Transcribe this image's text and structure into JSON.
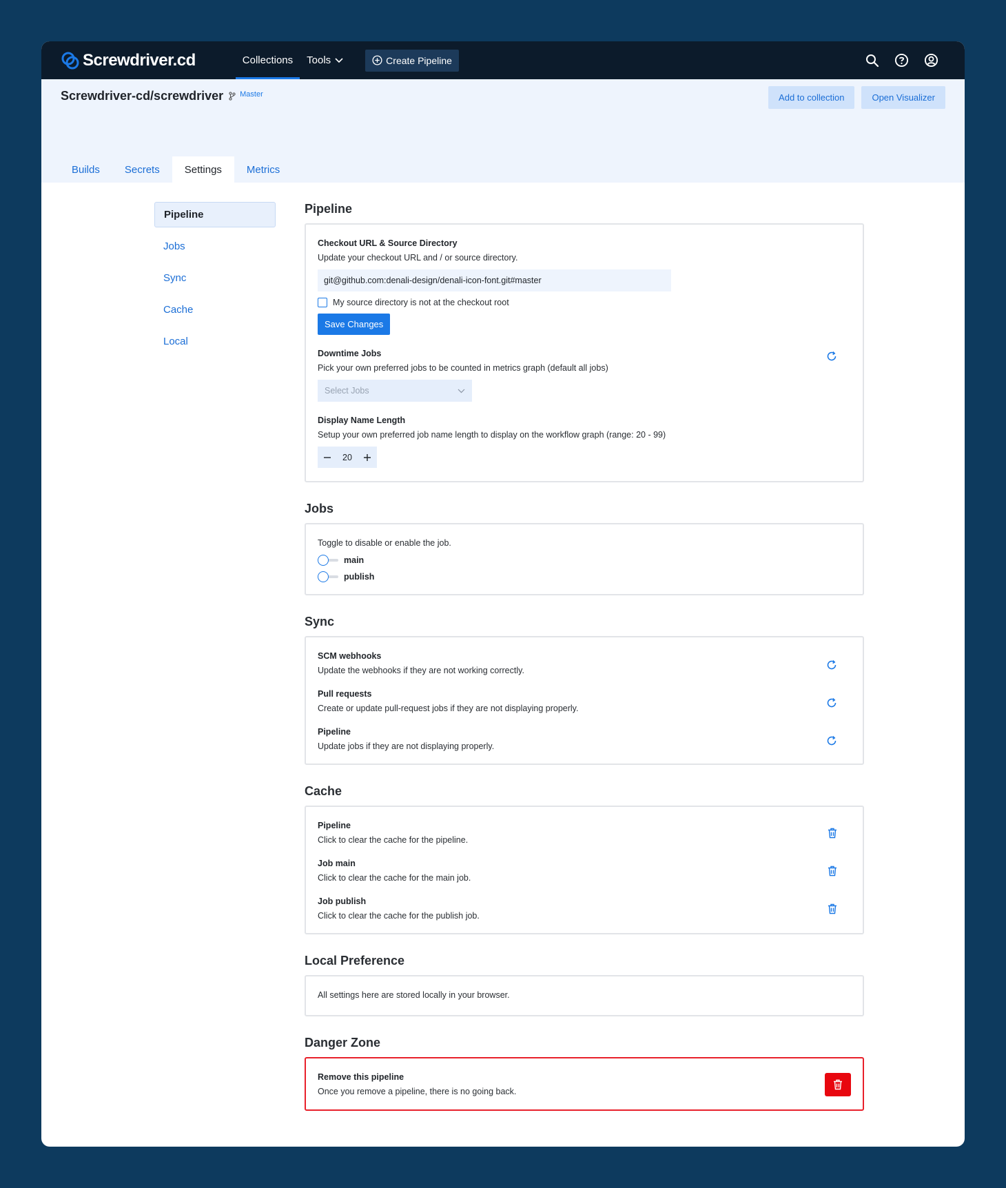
{
  "app": {
    "brand": "Screwdriver.cd"
  },
  "nav": {
    "collections": "Collections",
    "tools": "Tools",
    "create_pipeline": "Create Pipeline"
  },
  "header": {
    "repo": "Screwdriver-cd/screwdriver",
    "branch": "Master",
    "add_to_collection": "Add to collection",
    "open_visualizer": "Open Visualizer",
    "tabs": [
      "Builds",
      "Secrets",
      "Settings",
      "Metrics"
    ],
    "active_tab": "Settings"
  },
  "sidebar": {
    "items": [
      "Pipeline",
      "Jobs",
      "Sync",
      "Cache",
      "Local"
    ],
    "active": "Pipeline"
  },
  "pipeline": {
    "title": "Pipeline",
    "checkout": {
      "label": "Checkout URL & Source Directory",
      "desc": "Update your checkout URL and / or source directory.",
      "value": "git@github.com:denali-design/denali-icon-font.git#master",
      "checkbox_label": "My source directory is not at the checkout root",
      "checkbox_checked": false,
      "save": "Save Changes"
    },
    "downtime": {
      "label": "Downtime Jobs",
      "desc": "Pick your own preferred jobs to be counted in metrics graph (default all jobs)",
      "placeholder": "Select Jobs"
    },
    "display_length": {
      "label": "Display Name Length",
      "desc": "Setup your own preferred job name length to display on the workflow graph (range: 20 - 99)",
      "value": "20"
    }
  },
  "jobs": {
    "title": "Jobs",
    "desc": "Toggle to disable or enable the job.",
    "list": [
      {
        "name": "main",
        "enabled": false
      },
      {
        "name": "publish",
        "enabled": false
      }
    ]
  },
  "sync": {
    "title": "Sync",
    "items": [
      {
        "label": "SCM webhooks",
        "desc": "Update the webhooks if they are not working correctly."
      },
      {
        "label": "Pull requests",
        "desc": "Create or update pull-request jobs if they are not displaying properly."
      },
      {
        "label": "Pipeline",
        "desc": "Update jobs if they are not displaying properly."
      }
    ]
  },
  "cache": {
    "title": "Cache",
    "items": [
      {
        "label": "Pipeline",
        "desc": "Click to clear the cache for the pipeline."
      },
      {
        "label": "Job main",
        "desc": "Click to clear the cache for the main job."
      },
      {
        "label": "Job publish",
        "desc": "Click to clear the cache for the publish job."
      }
    ]
  },
  "local": {
    "title": "Local Preference",
    "desc": "All settings here are stored locally in your browser."
  },
  "danger": {
    "title": "Danger Zone",
    "label": "Remove this pipeline",
    "desc": "Once you remove a pipeline, there is no going back."
  },
  "colors": {
    "background": "#0d3a5e",
    "nav": "#0c1b2b",
    "accent": "#1b79e6",
    "danger": "#e8070f"
  }
}
